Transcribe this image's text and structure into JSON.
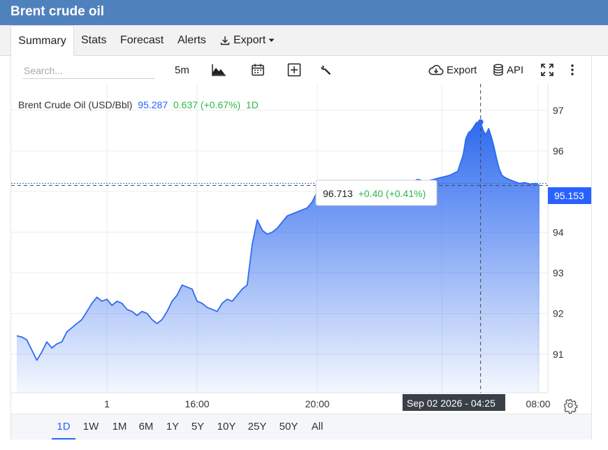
{
  "window": {
    "title": "Brent crude oil"
  },
  "tabs": [
    {
      "label": "Summary",
      "active": true
    },
    {
      "label": "Stats"
    },
    {
      "label": "Forecast"
    },
    {
      "label": "Alerts"
    },
    {
      "label": "Export"
    }
  ],
  "toolbar": {
    "search_placeholder": "Search...",
    "interval": "5m",
    "export_label": "Export",
    "api_label": "API",
    "icons": [
      "chart-type-icon",
      "calendar-icon",
      "add-indicator-icon",
      "wrench-icon",
      "cloud-download-icon",
      "database-icon",
      "fullscreen-icon",
      "more-vertical-icon",
      "download-icon",
      "caret-down-icon"
    ]
  },
  "legend": {
    "name": "Brent Crude Oil (USD/Bbl)",
    "price": "95.287",
    "change": "0.637 (+0.67%)",
    "period": "1D"
  },
  "tooltip": {
    "value": "96.713",
    "change": "+0.40 (+0.41%)"
  },
  "crosshair_time": "Sep 02 2026 - 04:25",
  "last_price_label": "95.153",
  "colors": {
    "header": "#4f81bd",
    "line": "#2f6bef",
    "fill_top": "#2f6bef",
    "up": "#2bb84a",
    "price_blue": "#2962ff",
    "time_tag": "#3a4048"
  },
  "chart_data": {
    "type": "area",
    "title": "Brent Crude Oil (USD/Bbl)",
    "xlabel": "",
    "ylabel": "",
    "y_ticks": [
      91,
      92,
      93,
      94,
      95,
      96,
      97
    ],
    "x_tick_labels": [
      "1",
      "16:00",
      "20:00",
      "2",
      "08:00"
    ],
    "ylim": [
      90.05,
      97.65
    ],
    "grid": true,
    "x": [
      "09-01 10:00",
      "09-01 10:10",
      "09-01 10:20",
      "09-01 10:30",
      "09-01 10:40",
      "09-01 10:50",
      "09-01 11:00",
      "09-01 11:10",
      "09-01 11:20",
      "09-01 11:30",
      "09-01 11:40",
      "09-01 11:50",
      "09-01 12:00",
      "09-01 12:10",
      "09-01 12:20",
      "09-01 12:30",
      "09-01 12:40",
      "09-01 12:50",
      "09-01 13:00",
      "09-01 13:10",
      "09-01 13:20",
      "09-01 13:30",
      "09-01 13:40",
      "09-01 13:50",
      "09-01 14:00",
      "09-01 14:10",
      "09-01 14:20",
      "09-01 14:30",
      "09-01 14:40",
      "09-01 14:50",
      "09-01 15:00",
      "09-01 15:10",
      "09-01 15:20",
      "09-01 15:30",
      "09-01 15:40",
      "09-01 15:50",
      "09-01 16:00",
      "09-01 16:10",
      "09-01 16:20",
      "09-01 16:30",
      "09-01 16:40",
      "09-01 16:50",
      "09-01 17:00",
      "09-01 17:10",
      "09-01 17:20",
      "09-01 17:30",
      "09-01 17:40",
      "09-01 17:50",
      "09-01 18:00",
      "09-01 18:10",
      "09-01 18:20",
      "09-01 18:30",
      "09-01 18:40",
      "09-01 18:50",
      "09-01 19:00",
      "09-01 19:10",
      "09-01 19:20",
      "09-01 19:30",
      "09-01 19:40",
      "09-01 19:50",
      "09-01 20:00",
      "09-01 20:10",
      "09-01 20:20",
      "09-01 20:30",
      "09-01 20:40",
      "09-01 20:50",
      "09-01 21:00",
      "09-01 21:10",
      "09-01 21:20",
      "09-01 21:30",
      "09-01 21:40",
      "09-01 21:50",
      "09-01 22:00",
      "09-01 22:30",
      "09-01 23:00",
      "09-01 23:30",
      "09-02 00:00",
      "09-02 00:30",
      "09-02 01:00",
      "09-02 01:30",
      "09-02 02:00",
      "09-02 02:30",
      "09-02 03:00",
      "09-02 03:10",
      "09-02 03:20",
      "09-02 03:30",
      "09-02 03:40",
      "09-02 03:50",
      "09-02 04:00",
      "09-02 04:10",
      "09-02 04:25",
      "09-02 04:35",
      "09-02 04:45",
      "09-02 04:55",
      "09-02 05:05",
      "09-02 05:15",
      "09-02 05:25",
      "09-02 05:35",
      "09-02 05:45",
      "09-02 05:55",
      "09-02 06:10",
      "09-02 06:30",
      "09-02 06:50",
      "09-02 07:10",
      "09-02 07:30",
      "09-02 07:50",
      "09-02 08:05"
    ],
    "values": [
      91.45,
      91.42,
      91.35,
      91.1,
      90.85,
      91.05,
      91.3,
      91.15,
      91.25,
      91.3,
      91.55,
      91.65,
      91.75,
      91.85,
      92.05,
      92.25,
      92.4,
      92.3,
      92.35,
      92.2,
      92.3,
      92.25,
      92.1,
      92.05,
      91.95,
      92.05,
      92.0,
      91.85,
      91.75,
      91.85,
      92.05,
      92.3,
      92.45,
      92.7,
      92.65,
      92.6,
      92.3,
      92.25,
      92.15,
      92.1,
      92.05,
      92.25,
      92.35,
      92.3,
      92.45,
      92.6,
      92.7,
      93.7,
      94.3,
      94.05,
      93.95,
      94.0,
      94.1,
      94.25,
      94.4,
      94.45,
      94.5,
      94.55,
      94.6,
      94.75,
      95.0,
      95.05,
      94.95,
      94.9,
      94.95,
      94.85,
      94.95,
      95.0,
      94.8,
      94.95,
      94.9,
      95.05,
      95.1,
      95.15,
      95.2,
      95.1,
      95.2,
      95.3,
      95.25,
      95.3,
      95.35,
      95.4,
      95.5,
      95.7,
      95.9,
      96.3,
      96.45,
      96.5,
      96.6,
      96.7,
      96.71,
      96.5,
      96.4,
      96.55,
      96.35,
      96.1,
      95.8,
      95.55,
      95.4,
      95.35,
      95.3,
      95.25,
      95.2,
      95.22,
      95.18,
      95.2,
      95.15
    ],
    "crosshair": {
      "x": "09-02 04:25",
      "y": 95.15
    }
  }
}
